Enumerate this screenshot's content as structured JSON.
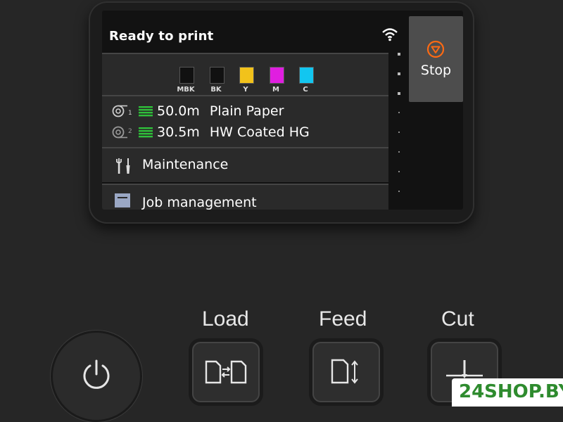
{
  "screen": {
    "status": "Ready to print",
    "wifi_icon": "wifi-icon"
  },
  "inks": [
    {
      "label": "MBK",
      "color": "#111111"
    },
    {
      "label": "BK",
      "color": "#111111"
    },
    {
      "label": "Y",
      "color": "#f2c21b"
    },
    {
      "label": "M",
      "color": "#e01ee0"
    },
    {
      "label": "C",
      "color": "#12c6f0"
    }
  ],
  "rolls": [
    {
      "number": "1",
      "length": "50.0m",
      "media": "Plain Paper",
      "level_color": "#2fbf3a"
    },
    {
      "number": "2",
      "length": "30.5m",
      "media": "HW Coated HG",
      "level_color": "#2fbf3a"
    }
  ],
  "menu": {
    "maintenance": "Maintenance",
    "job_management": "Job management"
  },
  "stop": {
    "label": "Stop",
    "icon_color": "#ff6a13"
  },
  "hardware": {
    "load": "Load",
    "feed": "Feed",
    "cut": "Cut"
  },
  "watermark": "24SHOP.BY"
}
